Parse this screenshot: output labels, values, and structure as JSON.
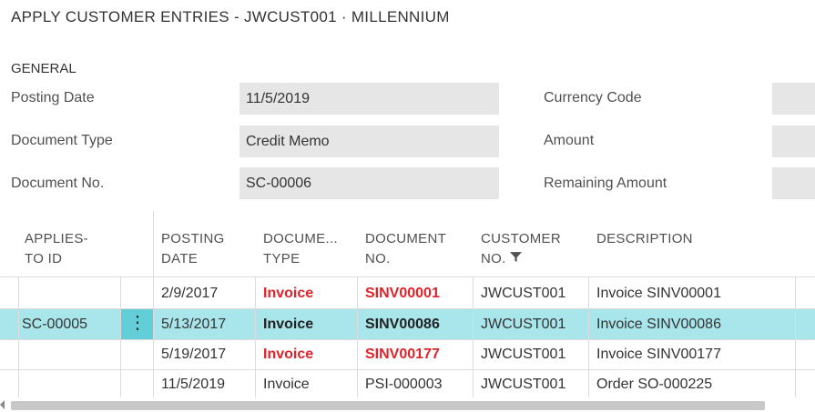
{
  "page_title": "APPLY CUSTOMER ENTRIES - JWCUST001 · MILLENNIUM",
  "general": {
    "section_title": "GENERAL",
    "posting_date_label": "Posting Date",
    "posting_date_value": "11/5/2019",
    "document_type_label": "Document Type",
    "document_type_value": "Credit Memo",
    "document_no_label": "Document No.",
    "document_no_value": "SC-00006",
    "currency_code_label": "Currency Code",
    "amount_label": "Amount",
    "remaining_amount_label": "Remaining Amount"
  },
  "table": {
    "headers": {
      "applies_to_id": [
        "APPLIES-",
        "TO ID"
      ],
      "posting_date": [
        "POSTING",
        "DATE"
      ],
      "document_type": [
        "DOCUME...",
        "TYPE"
      ],
      "document_no": [
        "DOCUMENT",
        "NO."
      ],
      "customer_no": [
        "CUSTOMER",
        "NO."
      ],
      "description": [
        "",
        "DESCRIPTION"
      ]
    },
    "rows": [
      {
        "applies_to_id": "",
        "posting_date": "2/9/2017",
        "document_type": "Invoice",
        "document_no": "SINV00001",
        "customer_no": "JWCUST001",
        "description": "Invoice SINV00001"
      },
      {
        "applies_to_id": "SC-00005",
        "posting_date": "5/13/2017",
        "document_type": "Invoice",
        "document_no": "SINV00086",
        "customer_no": "JWCUST001",
        "description": "Invoice SINV00086"
      },
      {
        "applies_to_id": "",
        "posting_date": "5/19/2017",
        "document_type": "Invoice",
        "document_no": "SINV00177",
        "customer_no": "JWCUST001",
        "description": "Invoice SINV00177"
      },
      {
        "applies_to_id": "",
        "posting_date": "11/5/2019",
        "document_type": "Invoice",
        "document_no": "PSI-000003",
        "customer_no": "JWCUST001",
        "description": "Order SO-000225"
      }
    ],
    "row_menu_icon": "vertical-ellipsis-icon",
    "filter_icon": "funnel-icon"
  },
  "colors": {
    "selected_row": "#a9e6ec",
    "row_menu": "#62cfd8",
    "overdue_text": "#e0232a",
    "field_bg": "#e6e6e6"
  }
}
